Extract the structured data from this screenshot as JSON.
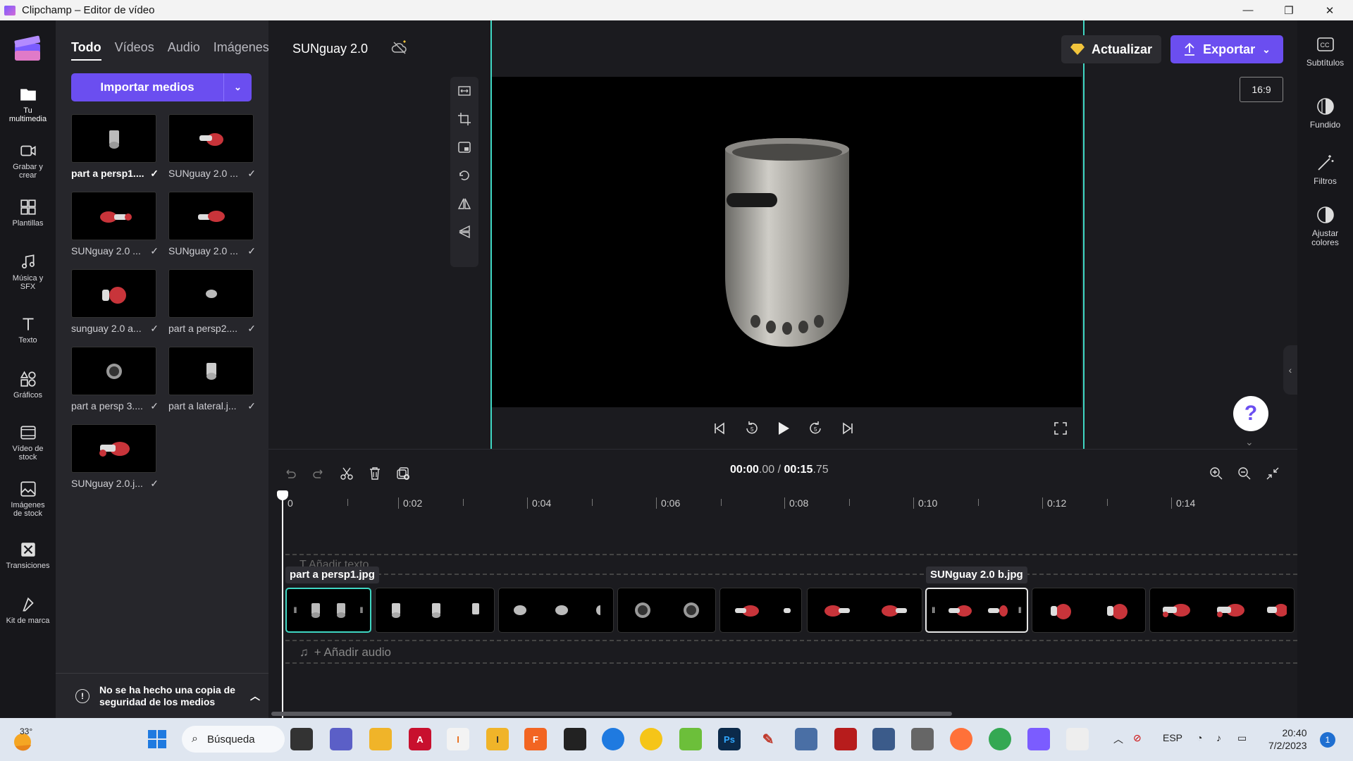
{
  "window": {
    "title": "Clipchamp – Editor de vídeo",
    "minimize": "—",
    "restore": "❐",
    "close": "✕"
  },
  "leftnav": [
    {
      "label": "Tu multimedia",
      "icon": "folder-icon"
    },
    {
      "label": "Grabar y crear",
      "icon": "camera-icon"
    },
    {
      "label": "Plantillas",
      "icon": "templates-icon"
    },
    {
      "label": "Música y SFX",
      "icon": "music-icon"
    },
    {
      "label": "Texto",
      "icon": "text-icon"
    },
    {
      "label": "Gráficos",
      "icon": "shapes-icon"
    },
    {
      "label": "Vídeo de stock",
      "icon": "stock-video-icon"
    },
    {
      "label": "Imágenes de stock",
      "icon": "stock-image-icon"
    },
    {
      "label": "Transiciones",
      "icon": "transitions-icon"
    },
    {
      "label": "Kit de marca",
      "icon": "brand-kit-icon"
    }
  ],
  "media": {
    "tabs": [
      "Todo",
      "Vídeos",
      "Audio",
      "Imágenes"
    ],
    "import_label": "Importar medios",
    "items": [
      {
        "name": "part a persp1...."
      },
      {
        "name": "SUNguay 2.0 ..."
      },
      {
        "name": "SUNguay 2.0 ..."
      },
      {
        "name": "SUNguay 2.0 ..."
      },
      {
        "name": "sunguay 2.0 a..."
      },
      {
        "name": "part a persp2...."
      },
      {
        "name": "part a persp 3...."
      },
      {
        "name": "part a lateral.j..."
      },
      {
        "name": "SUNguay 2.0.j..."
      }
    ],
    "backup_notice": "No se ha hecho una copia de seguridad de los medios"
  },
  "editor": {
    "project_name": "SUNguay 2.0",
    "update_label": "Actualizar",
    "export_label": "Exportar",
    "aspect_ratio": "16:9",
    "help": "?"
  },
  "rightnav": [
    {
      "label": "Subtítulos",
      "icon": "captions-icon"
    },
    {
      "label": "Fundido",
      "icon": "fade-icon"
    },
    {
      "label": "Filtros",
      "icon": "filters-icon"
    },
    {
      "label": "Ajustar colores",
      "icon": "adjust-colors-icon"
    }
  ],
  "timeline": {
    "current": "00:00",
    "current_frac": ".00",
    "separator": " / ",
    "total": "00:15",
    "total_frac": ".75",
    "ruler_labels": [
      "0",
      "0:02",
      "0:04",
      "0:06",
      "0:08",
      "0:10",
      "0:12",
      "0:14"
    ],
    "text_track": "T  Añadir texto",
    "audio_track": "+ Añadir audio",
    "clip_tag_first": "part a persp1.jpg",
    "clip_tag_selected": "SUNguay 2.0 b.jpg"
  },
  "taskbar": {
    "weather": "33°",
    "search_label": "Búsqueda",
    "language": "ESP",
    "time": "20:40",
    "date": "7/2/2023",
    "notifications": "1"
  },
  "colors": {
    "accent": "#6b4ef0",
    "playhead_frame": "#3fd7c3",
    "panel": "#26262b",
    "background": "#1b1b1f"
  }
}
